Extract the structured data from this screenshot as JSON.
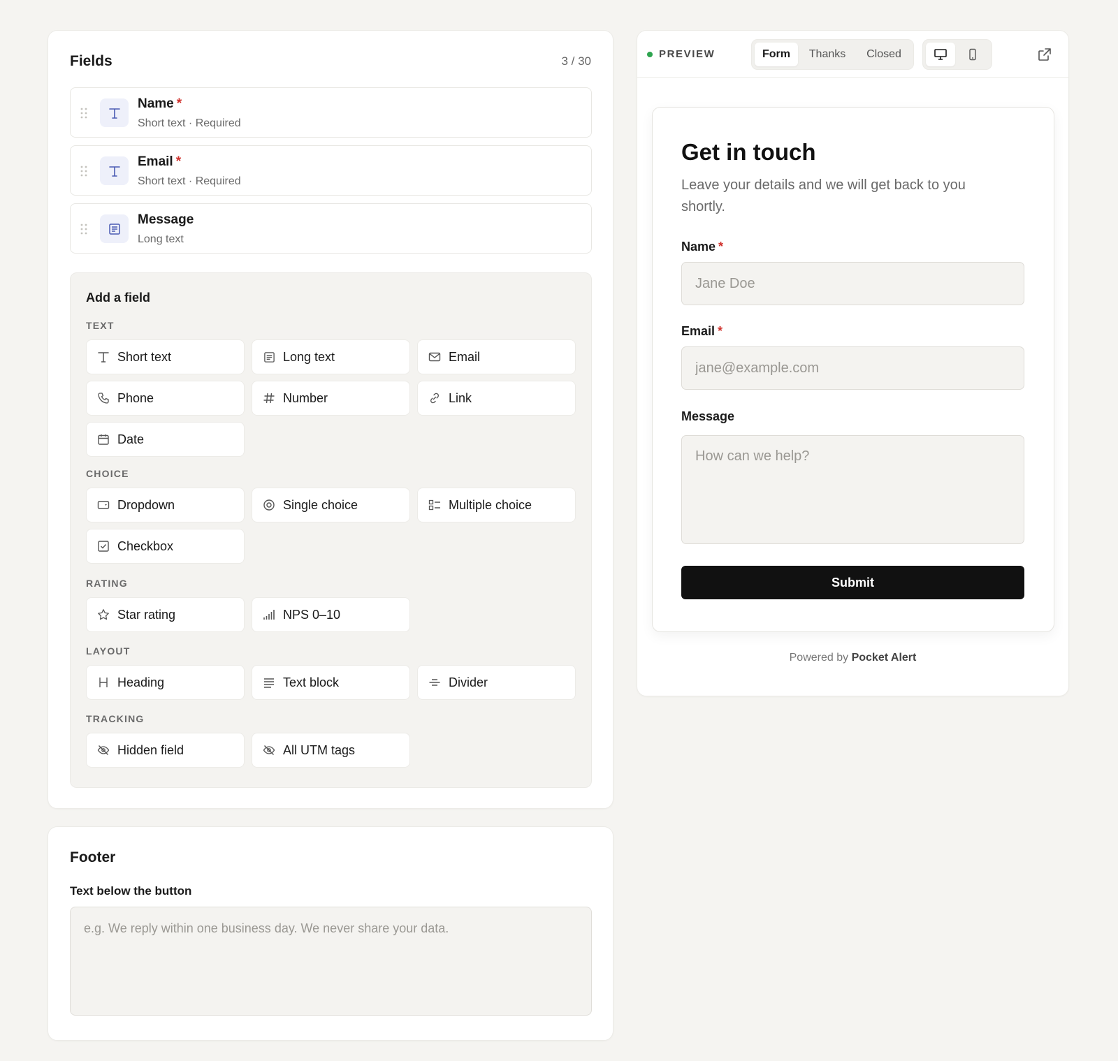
{
  "fields_panel": {
    "title": "Fields",
    "count": "3 / 30",
    "fields": [
      {
        "name": "Name",
        "required": "*",
        "sub": "Short text · Required",
        "icon": "text-type-icon"
      },
      {
        "name": "Email",
        "required": "*",
        "sub": "Short text · Required",
        "icon": "text-type-icon"
      },
      {
        "name": "Message",
        "required": "",
        "sub": "Long text",
        "icon": "long-text-icon"
      }
    ]
  },
  "add_field": {
    "title": "Add a field",
    "sections": {
      "text": {
        "label": "TEXT",
        "items": [
          "Short text",
          "Long text",
          "Email",
          "Phone",
          "Number",
          "Link",
          "Date"
        ]
      },
      "choice": {
        "label": "CHOICE",
        "items": [
          "Dropdown",
          "Single choice",
          "Multiple choice",
          "Checkbox"
        ]
      },
      "rating": {
        "label": "RATING",
        "items": [
          "Star rating",
          "NPS 0–10"
        ]
      },
      "layout": {
        "label": "LAYOUT",
        "items": [
          "Heading",
          "Text block",
          "Divider"
        ]
      },
      "tracking": {
        "label": "TRACKING",
        "items": [
          "Hidden field",
          "All UTM tags"
        ]
      }
    }
  },
  "footer": {
    "title": "Footer",
    "label": "Text below the button",
    "placeholder": "e.g. We reply within one business day. We never share your data."
  },
  "preview": {
    "label": "PREVIEW",
    "tabs": [
      "Form",
      "Thanks",
      "Closed"
    ],
    "active_tab": "Form",
    "devices": [
      "desktop-icon",
      "mobile-icon"
    ],
    "form": {
      "title": "Get in touch",
      "description": "Leave your details and we will get back to you shortly.",
      "name_label": "Name",
      "name_required": "*",
      "name_placeholder": "Jane Doe",
      "email_label": "Email",
      "email_required": "*",
      "email_placeholder": "jane@example.com",
      "message_label": "Message",
      "message_placeholder": "How can we help?",
      "submit": "Submit"
    },
    "powered_prefix": "Powered by",
    "powered_brand": "Pocket Alert"
  },
  "colors": {
    "background": "#f5f4f1",
    "accent_icon": "#4a5bb3",
    "required": "#d0322d",
    "status": "#2ea44f",
    "button": "#111111"
  }
}
